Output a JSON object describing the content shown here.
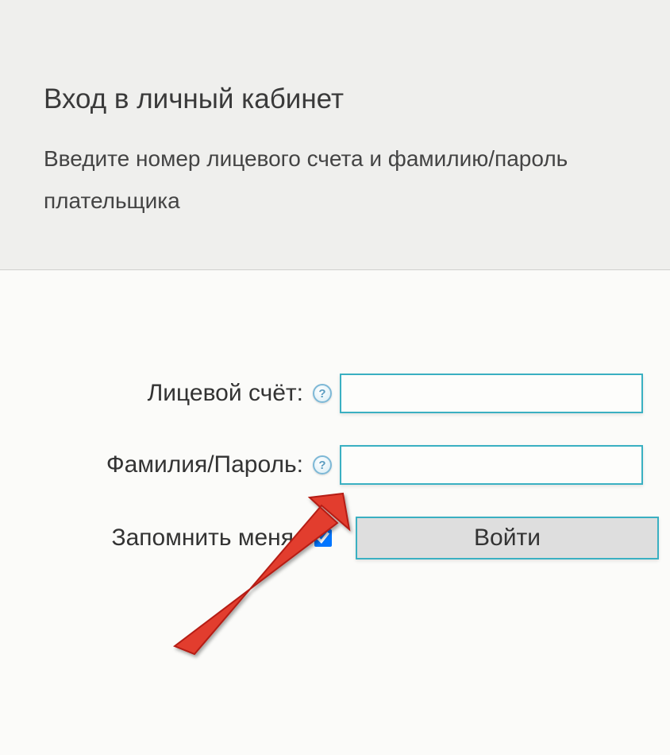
{
  "header": {
    "title": "Вход в личный кабинет",
    "subtitle": "Введите номер лицевого счета и фамилию/пароль плательщика"
  },
  "form": {
    "account_label": "Лицевой счёт:",
    "account_value": "",
    "password_label": "Фамилия/Пароль:",
    "password_value": "",
    "remember_label": "Запомнить меня",
    "submit_label": "Войти",
    "help_icon_text": "?"
  },
  "colors": {
    "header_bg": "#efefed",
    "border_teal": "#3ab0c2",
    "button_bg": "#dedede",
    "arrow_red": "#e23c2d"
  }
}
